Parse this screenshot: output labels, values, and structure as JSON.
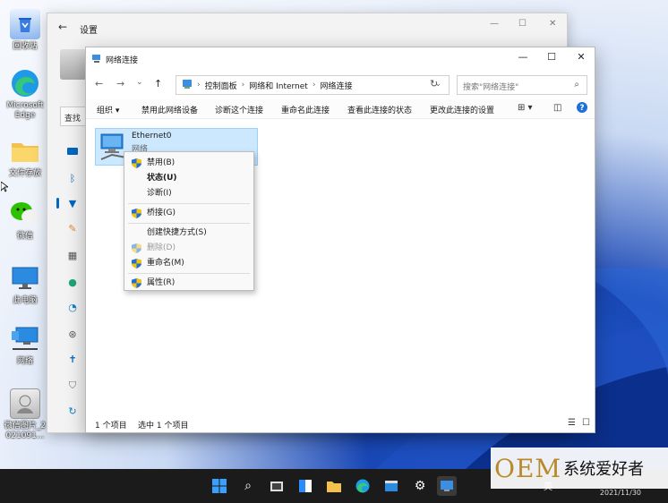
{
  "desktop": {
    "icons": [
      {
        "label": "回收站"
      },
      {
        "label": "Microsoft Edge"
      },
      {
        "label": "文件存放"
      },
      {
        "label": "微信"
      },
      {
        "label": "此电脑"
      },
      {
        "label": "网络"
      },
      {
        "label": "微信图片_2021091..."
      }
    ]
  },
  "settings": {
    "title": "设置",
    "search_text": "查找"
  },
  "explorer": {
    "title": "网络连接",
    "window_buttons": {
      "minimize": "—",
      "maximize": "☐",
      "close": "✕"
    },
    "breadcrumb": [
      "控制面板",
      "网络和 Internet",
      "网络连接"
    ],
    "search_placeholder": "搜索\"网络连接\"",
    "toolbar": {
      "organize": "组织 ▾",
      "disable": "禁用此网络设备",
      "diagnose": "诊断这个连接",
      "rename": "重命名此连接",
      "status": "查看此连接的状态",
      "change": "更改此连接的设置"
    },
    "item": {
      "name": "Ethernet0",
      "sub": "网络"
    },
    "status_bar": {
      "count": "1 个项目",
      "selected": "选中 1 个项目"
    }
  },
  "context_menu": {
    "items": [
      {
        "label": "禁用(B)"
      },
      {
        "label": "状态(U)"
      },
      {
        "label": "诊断(I)"
      },
      {
        "label": "桥接(G)"
      },
      {
        "label": "创建快捷方式(S)"
      },
      {
        "label": "删除(D)"
      },
      {
        "label": "重命名(M)"
      },
      {
        "label": "属性(R)"
      }
    ]
  },
  "taskbar": {
    "ime": "英",
    "date": "2021/11/30"
  },
  "watermark": {
    "brand": "OEM",
    "text": "系统爱好者"
  },
  "colors": {
    "accent": "#0067c0",
    "selection": "#cce8ff",
    "shield_blue": "#1e6fd9",
    "shield_yellow": "#f4c20d",
    "taskbar": "#1b1b1b"
  }
}
